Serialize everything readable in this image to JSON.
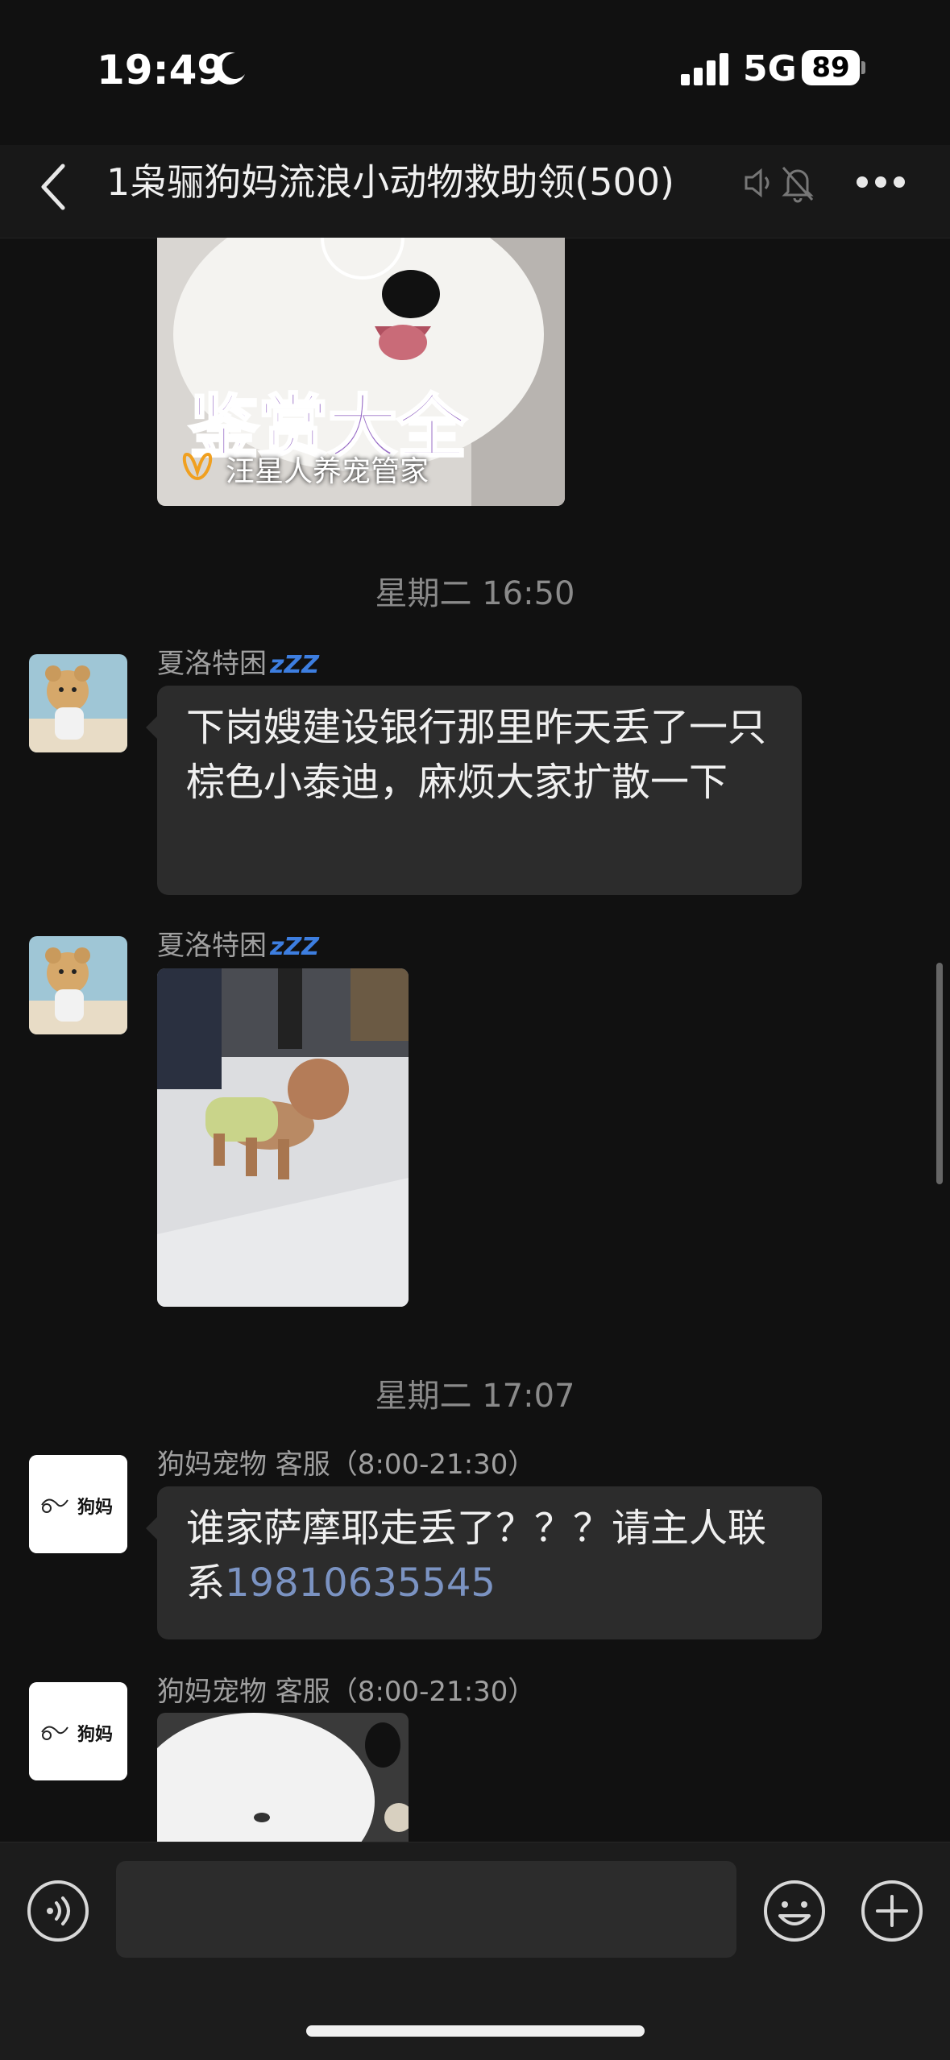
{
  "status_bar": {
    "time": "19:49",
    "network": "5G",
    "battery": "89"
  },
  "header": {
    "title": "1枭骊狗妈流浪小动物救助领(500)"
  },
  "messages": {
    "top_image_caption": "汪星人养宠管家",
    "image_text": "鉴赏大全",
    "timestamp_1": "星期二 16:50",
    "msg1": {
      "sender": "夏洛特困",
      "text": "下岗嫂建设银行那里昨天丢了一只棕色小泰迪，麻烦大家扩散一下"
    },
    "msg2": {
      "sender": "夏洛特困"
    },
    "timestamp_2": "星期二 17:07",
    "msg3": {
      "sender": "狗妈宠物 客服（8:00-21:30）",
      "text": "谁家萨摩耶走丢了？？？请主人联系",
      "phone": "19810635545"
    },
    "msg4": {
      "sender": "狗妈宠物 客服（8:00-21:30）"
    },
    "sleep_badge": "zZZ",
    "avatar_logo_text": "狗妈"
  },
  "colors": {
    "background": "#111111",
    "bubble": "#2c2c2c",
    "link": "#7b93c2",
    "sleep_badge": "#3d7ee0"
  }
}
